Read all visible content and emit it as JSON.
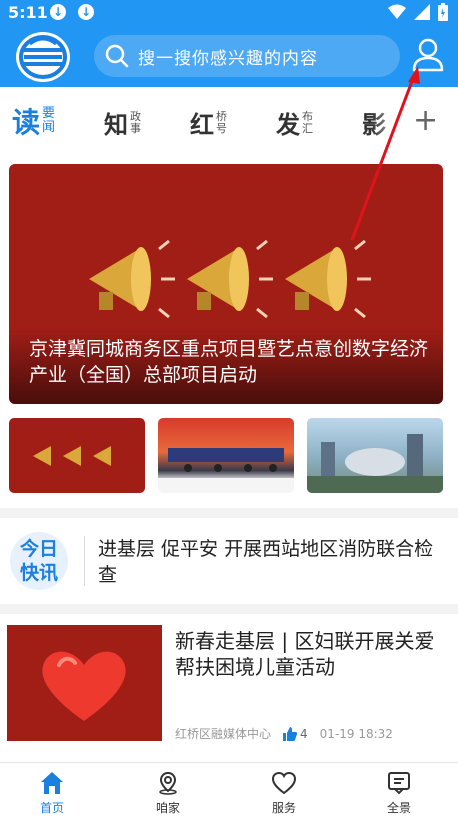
{
  "status_bar": {
    "time": "5:11"
  },
  "header": {
    "search_placeholder": "搜一搜你感兴趣的内容"
  },
  "tabs": [
    {
      "big": "读",
      "small": "要闻",
      "active": true
    },
    {
      "big": "知",
      "small": "政事",
      "active": false
    },
    {
      "big": "红",
      "small": "桥号",
      "active": false
    },
    {
      "big": "发",
      "small": "布汇",
      "active": false
    },
    {
      "big": "影",
      "small": "",
      "active": false
    }
  ],
  "hero": {
    "caption": "京津冀同城商务区重点项目暨艺点意创数字经济产业（全国）总部项目启动"
  },
  "kuaixun": {
    "badge_line1": "今日",
    "badge_line2": "快讯",
    "text": "进基层 促平安 开展西站地区消防联合检查"
  },
  "news": [
    {
      "title": "新春走基层 | 区妇联开展关爱帮扶困境儿童活动",
      "source": "红桥区融媒体中心",
      "likes": "4",
      "time": "01-19 18:32"
    }
  ],
  "bottom_nav": [
    {
      "label": "首页",
      "icon": "home-icon",
      "active": true
    },
    {
      "label": "咱家",
      "icon": "location-icon",
      "active": false
    },
    {
      "label": "服务",
      "icon": "heart-icon",
      "active": false
    },
    {
      "label": "全景",
      "icon": "panorama-icon",
      "active": false
    }
  ],
  "colors": {
    "primary": "#2196f3",
    "accent": "#1b7fe0",
    "hero_bg": "#a11e17"
  }
}
